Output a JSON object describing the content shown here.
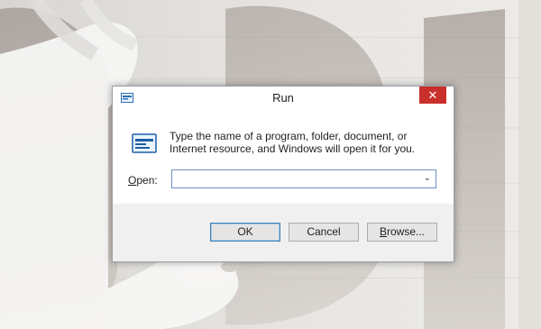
{
  "dialog": {
    "title": "Run",
    "close_glyph": "✕",
    "description": "Type the name of a program, folder, document, or Internet resource, and Windows will open it for you.",
    "open_label_first": "O",
    "open_label_rest": "pen:",
    "open_value": "",
    "dropdown_glyph": "⌄"
  },
  "buttons": {
    "ok": "OK",
    "cancel": "Cancel",
    "browse_first": "B",
    "browse_rest": "rowse..."
  },
  "icons": {
    "title_icon": "run-icon",
    "content_icon": "run-large-icon",
    "close_icon": "close-icon",
    "dropdown_icon": "chevron-down-icon"
  },
  "colors": {
    "close_button": "#c9302c",
    "default_button_border": "#3c7fb1",
    "input_border": "#6f8fbd"
  }
}
